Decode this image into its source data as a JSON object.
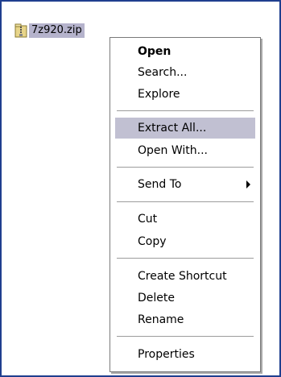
{
  "file": {
    "name": "7z920.zip",
    "icon": "zip-folder-icon"
  },
  "menu": {
    "items": [
      {
        "label": "Open"
      },
      {
        "label": "Search..."
      },
      {
        "label": "Explore"
      },
      {
        "label": "Extract All..."
      },
      {
        "label": "Open With..."
      },
      {
        "label": "Send To"
      },
      {
        "label": "Cut"
      },
      {
        "label": "Copy"
      },
      {
        "label": "Create Shortcut"
      },
      {
        "label": "Delete"
      },
      {
        "label": "Rename"
      },
      {
        "label": "Properties"
      }
    ],
    "submenu_icon": "chevron-right-icon"
  },
  "colors": {
    "frame_border": "#1f3f8f",
    "selection": "#c1c0d2",
    "file_selection": "#b5b3cc"
  }
}
